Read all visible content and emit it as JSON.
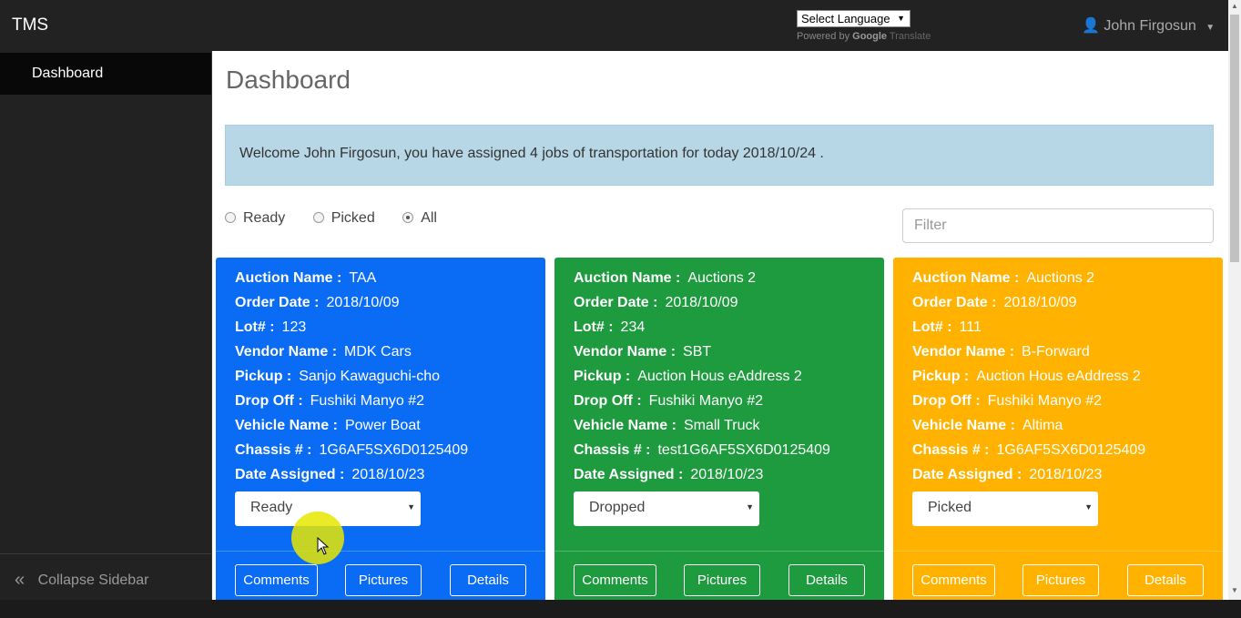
{
  "app": {
    "brand": "TMS"
  },
  "language": {
    "select_label": "Select Language",
    "powered_by": "Powered by",
    "google": "Google",
    "translate": "Translate"
  },
  "user": {
    "name": "John Firgosun"
  },
  "sidebar": {
    "items": [
      {
        "label": "Dashboard"
      }
    ],
    "collapse_label": "Collapse Sidebar"
  },
  "main": {
    "title": "Dashboard",
    "welcome": "Welcome John Firgosun, you have assigned 4 jobs of transportation for today 2018/10/24 .",
    "filters": {
      "options": [
        "Ready",
        "Picked",
        "All"
      ],
      "selected": "All"
    },
    "filter_placeholder": "Filter"
  },
  "card_labels": {
    "auction_name": "Auction Name :",
    "order_date": "Order Date :",
    "lot": "Lot# :",
    "vendor_name": "Vendor Name :",
    "pickup": "Pickup :",
    "drop_off": "Drop Off :",
    "vehicle_name": "Vehicle Name :",
    "chassis": "Chassis # :",
    "date_assigned": "Date Assigned :",
    "comments_button": "Comments",
    "pictures_button": "Pictures",
    "details_button": "Details"
  },
  "cards": [
    {
      "color": "#0a6cf5",
      "auction_name": "TAA",
      "order_date": "2018/10/09",
      "lot": "123",
      "vendor_name": "MDK Cars",
      "pickup": "Sanjo Kawaguchi-cho",
      "drop_off": "Fushiki Manyo #2",
      "vehicle_name": "Power Boat",
      "chassis": "1G6AF5SX6D0125409",
      "date_assigned": "2018/10/23",
      "status": "Ready"
    },
    {
      "color": "#1e9b3e",
      "auction_name": "Auctions 2",
      "order_date": "2018/10/09",
      "lot": "234",
      "vendor_name": "SBT",
      "pickup": "Auction Hous eAddress 2",
      "drop_off": "Fushiki Manyo #2",
      "vehicle_name": "Small Truck",
      "chassis": "test1G6AF5SX6D0125409",
      "date_assigned": "2018/10/23",
      "status": "Dropped"
    },
    {
      "color": "#ffb300",
      "auction_name": "Auctions 2",
      "order_date": "2018/10/09",
      "lot": "111",
      "vendor_name": "B-Forward",
      "pickup": "Auction Hous eAddress 2",
      "drop_off": "Fushiki Manyo #2",
      "vehicle_name": "Altima",
      "chassis": "1G6AF5SX6D0125409",
      "date_assigned": "2018/10/23",
      "status": "Picked"
    }
  ]
}
